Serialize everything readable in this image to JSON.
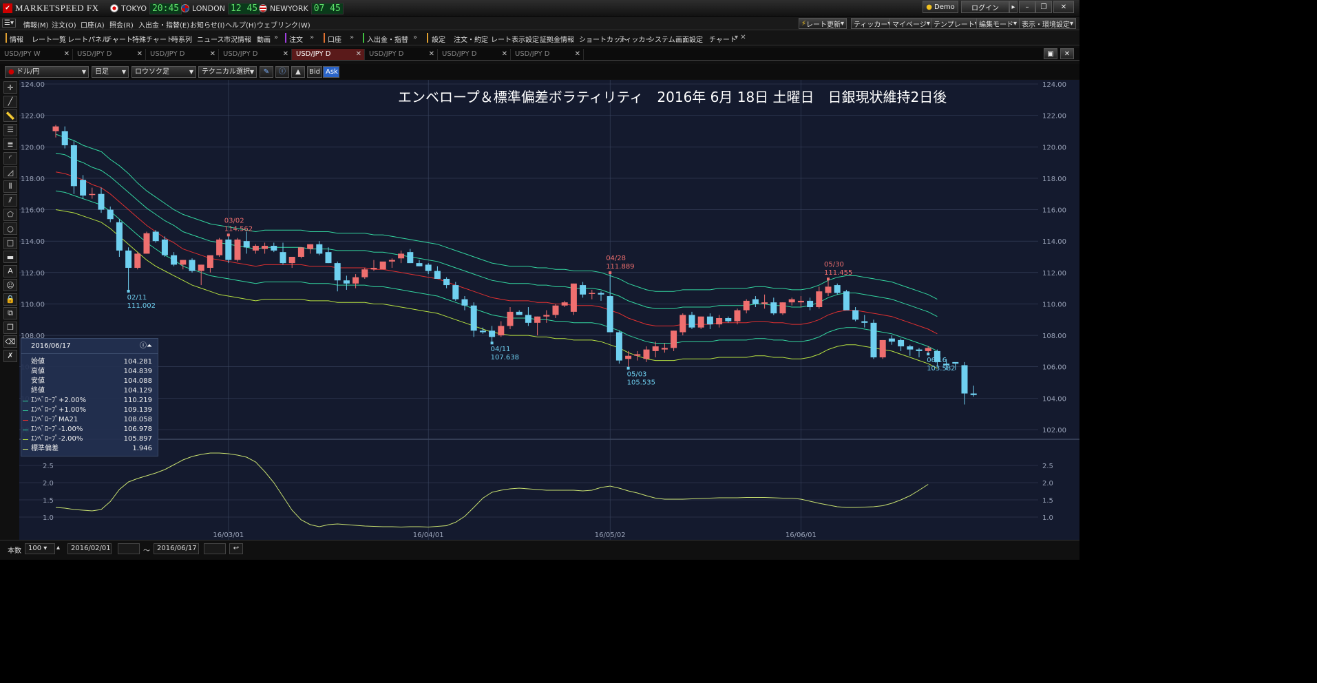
{
  "app": {
    "name": "MARKETSPEED FX"
  },
  "clocks": [
    {
      "city": "TOKYO",
      "time": "20:45"
    },
    {
      "city": "LONDON",
      "time": "12 45"
    },
    {
      "city": "NEWYORK",
      "time": "07 45"
    }
  ],
  "window_buttons": {
    "demo": "Demo",
    "login": "ログイン"
  },
  "menu": [
    "情報(M)",
    "注文(O)",
    "口座(A)",
    "照会(R)",
    "入出金・指替(E)",
    "お知らせ(I)",
    "ヘルプ(H)",
    "ウェブリンク(W)"
  ],
  "menu_right": [
    "レート更新",
    "ティッカー",
    "マイページ",
    "テンプレート",
    "編集モード",
    "表示・環境設定"
  ],
  "toolbar": [
    "情報",
    "レート一覧",
    "レートパネル",
    "チャート",
    "特殊チャート",
    "時系列",
    "ニュース",
    "市況情報",
    "動画",
    "注文",
    "口座",
    "入出金・指替",
    "設定",
    "注文・約定",
    "レート表示設定",
    "証拠金情報",
    "ショートカット",
    "ティッカー",
    "システム",
    "画面設定",
    "チャート"
  ],
  "tabs": [
    "USD/JPY W",
    "USD/JPY D",
    "USD/JPY D",
    "USD/JPY D",
    "USD/JPY D",
    "USD/JPY D",
    "USD/JPY D",
    "USD/JPY D"
  ],
  "active_tab": 4,
  "controls": {
    "pair": "ドル/円",
    "period": "日足",
    "chart_style": "ロウソク足",
    "technical": "テクニカル選択",
    "bid": "Bid",
    "ask": "Ask"
  },
  "chart_title": "エンベロープ＆標準偏差ボラティリティ　2016年 6月 18日 土曜日　日銀現状維持2日後",
  "info_panel": {
    "date": "2016/06/17",
    "rows": [
      {
        "label": "始値",
        "value": "104.281"
      },
      {
        "label": "高値",
        "value": "104.839"
      },
      {
        "label": "安値",
        "value": "104.088"
      },
      {
        "label": "終値",
        "value": "104.129"
      },
      {
        "label": "ｴﾝﾍﾞﾛｰﾌﾟ+2.00%",
        "value": "110.219",
        "color": "#33d6a0"
      },
      {
        "label": "ｴﾝﾍﾞﾛｰﾌﾟ+1.00%",
        "value": "109.139",
        "color": "#33d6a0"
      },
      {
        "label": "ｴﾝﾍﾞﾛｰﾌﾟMA21",
        "value": "108.058",
        "color": "#e03030"
      },
      {
        "label": "ｴﾝﾍﾞﾛｰﾌﾟ-1.00%",
        "value": "106.978",
        "color": "#33d6a0"
      },
      {
        "label": "ｴﾝﾍﾞﾛｰﾌﾟ-2.00%",
        "value": "105.897",
        "color": "#b6e040"
      },
      {
        "label": "標準偏差",
        "value": "1.946",
        "color": "#c8e070"
      }
    ]
  },
  "bottom": {
    "count_label": "本数",
    "count": "100",
    "from": "2016/02/01",
    "tilde": "〜",
    "to": "2016/06/17"
  },
  "colors": {
    "up": "#ef6f6f",
    "down": "#6fd0f0",
    "bg": "#141a2e",
    "grid": "#3a4560"
  },
  "chart_data": {
    "type": "candlestick",
    "ylim": [
      102,
      124
    ],
    "yticks": [
      "124.00",
      "122.00",
      "120.00",
      "118.00",
      "116.00",
      "114.00",
      "112.00",
      "110.00",
      "108.00",
      "106.00",
      "104.00",
      "102.00"
    ],
    "sub_ylim": [
      0.5,
      3.0
    ],
    "sub_yticks": [
      "2.5",
      "2.0",
      "1.5",
      "1.0"
    ],
    "xlabels": [
      {
        "i": 19,
        "label": "16/03/01"
      },
      {
        "i": 41,
        "label": "16/04/01"
      },
      {
        "i": 61,
        "label": "16/05/02"
      },
      {
        "i": 82,
        "label": "16/06/01"
      }
    ],
    "candles": [
      [
        121.0,
        121.4,
        120.6,
        121.3
      ],
      [
        121.0,
        121.3,
        119.9,
        120.1
      ],
      [
        120.1,
        120.4,
        117.0,
        117.5
      ],
      [
        117.9,
        118.2,
        116.7,
        116.9
      ],
      [
        117.0,
        117.4,
        116.7,
        117.0
      ],
      [
        117.0,
        117.4,
        115.8,
        116.0
      ],
      [
        116.0,
        116.2,
        115.2,
        115.4
      ],
      [
        115.2,
        115.4,
        113.0,
        113.4
      ],
      [
        113.4,
        113.6,
        110.9,
        112.3
      ],
      [
        112.3,
        113.3,
        112.2,
        113.2
      ],
      [
        113.2,
        114.6,
        113.2,
        114.5
      ],
      [
        114.6,
        114.7,
        113.9,
        114.0
      ],
      [
        114.1,
        114.3,
        113.0,
        113.1
      ],
      [
        113.1,
        113.3,
        112.4,
        112.5
      ],
      [
        112.5,
        112.8,
        112.2,
        112.8
      ],
      [
        112.8,
        112.9,
        112.0,
        112.1
      ],
      [
        112.1,
        112.5,
        111.2,
        112.5
      ],
      [
        112.3,
        113.0,
        112.0,
        113.1
      ],
      [
        113.1,
        114.2,
        113.0,
        114.1
      ],
      [
        114.1,
        114.3,
        112.6,
        112.8
      ],
      [
        112.8,
        114.2,
        112.7,
        114.1
      ],
      [
        114.0,
        114.6,
        113.2,
        113.6
      ],
      [
        113.4,
        113.8,
        113.2,
        113.7
      ],
      [
        113.5,
        113.9,
        113.2,
        113.7
      ],
      [
        113.7,
        113.9,
        113.3,
        113.4
      ],
      [
        113.3,
        113.9,
        112.5,
        112.6
      ],
      [
        112.6,
        113.0,
        112.3,
        113.0
      ],
      [
        113.0,
        113.4,
        112.9,
        113.6
      ],
      [
        113.5,
        113.8,
        113.2,
        113.8
      ],
      [
        113.8,
        114.0,
        113.1,
        113.2
      ],
      [
        113.3,
        113.6,
        112.6,
        112.6
      ],
      [
        112.6,
        112.7,
        110.8,
        111.5
      ],
      [
        111.5,
        111.8,
        110.9,
        111.3
      ],
      [
        111.3,
        111.9,
        111.0,
        111.7
      ],
      [
        111.7,
        112.3,
        111.6,
        112.2
      ],
      [
        112.2,
        112.8,
        112.1,
        112.3
      ],
      [
        112.2,
        112.6,
        112.2,
        112.7
      ],
      [
        112.7,
        112.9,
        112.3,
        112.8
      ],
      [
        112.9,
        113.4,
        112.6,
        113.2
      ],
      [
        113.3,
        113.5,
        112.6,
        112.6
      ],
      [
        112.6,
        112.8,
        112.4,
        112.4
      ],
      [
        112.5,
        112.6,
        111.9,
        112.1
      ],
      [
        112.1,
        112.4,
        111.6,
        111.6
      ],
      [
        111.6,
        111.7,
        111.0,
        111.2
      ],
      [
        111.2,
        111.4,
        110.2,
        110.3
      ],
      [
        110.3,
        110.5,
        109.6,
        109.9
      ],
      [
        109.9,
        110.1,
        107.9,
        108.3
      ],
      [
        108.3,
        108.5,
        108.1,
        108.2
      ],
      [
        108.3,
        108.6,
        107.6,
        107.9
      ],
      [
        108.0,
        108.9,
        107.9,
        108.6
      ],
      [
        108.6,
        109.8,
        108.4,
        109.5
      ],
      [
        109.5,
        109.6,
        109.3,
        109.3
      ],
      [
        109.3,
        109.8,
        108.6,
        108.8
      ],
      [
        108.8,
        109.2,
        108.0,
        109.2
      ],
      [
        109.2,
        109.6,
        108.8,
        109.3
      ],
      [
        109.3,
        110.0,
        109.1,
        109.9
      ],
      [
        109.9,
        110.2,
        109.8,
        110.1
      ],
      [
        109.5,
        111.3,
        109.3,
        111.3
      ],
      [
        111.2,
        111.4,
        110.4,
        110.6
      ],
      [
        110.7,
        110.9,
        110.3,
        110.7
      ],
      [
        110.7,
        110.8,
        110.2,
        110.6
      ],
      [
        110.5,
        111.9,
        108.9,
        108.2
      ],
      [
        108.2,
        108.3,
        106.2,
        106.4
      ],
      [
        106.5,
        107.0,
        106.0,
        106.7
      ],
      [
        106.7,
        107.0,
        106.4,
        106.8
      ],
      [
        106.5,
        107.3,
        106.3,
        107.1
      ],
      [
        107.0,
        107.6,
        106.6,
        107.3
      ],
      [
        107.1,
        107.5,
        106.9,
        107.2
      ],
      [
        107.2,
        108.3,
        107.0,
        108.3
      ],
      [
        108.2,
        109.4,
        108.0,
        109.3
      ],
      [
        109.3,
        109.5,
        108.4,
        108.5
      ],
      [
        108.5,
        109.2,
        108.4,
        109.2
      ],
      [
        109.2,
        109.4,
        108.4,
        108.7
      ],
      [
        108.7,
        109.3,
        108.5,
        109.1
      ],
      [
        109.1,
        109.2,
        108.8,
        108.9
      ],
      [
        108.9,
        109.7,
        108.7,
        109.6
      ],
      [
        109.6,
        110.3,
        109.4,
        110.2
      ],
      [
        110.3,
        110.5,
        109.8,
        110.0
      ],
      [
        110.0,
        110.6,
        109.7,
        110.1
      ],
      [
        110.1,
        110.4,
        109.3,
        109.4
      ],
      [
        109.4,
        110.1,
        109.3,
        110.1
      ],
      [
        110.1,
        110.4,
        109.9,
        110.3
      ],
      [
        110.1,
        110.5,
        109.8,
        110.2
      ],
      [
        110.2,
        110.4,
        109.6,
        109.8
      ],
      [
        109.8,
        111.1,
        109.7,
        110.8
      ],
      [
        110.7,
        111.5,
        110.5,
        111.1
      ],
      [
        111.2,
        111.3,
        110.6,
        110.7
      ],
      [
        110.8,
        110.9,
        109.8,
        109.6
      ],
      [
        109.6,
        109.8,
        108.9,
        109.0
      ],
      [
        108.9,
        109.3,
        108.5,
        108.8
      ],
      [
        108.8,
        109.0,
        106.5,
        106.6
      ],
      [
        106.6,
        107.7,
        106.5,
        107.7
      ],
      [
        107.8,
        108.0,
        107.4,
        107.6
      ],
      [
        107.7,
        107.8,
        107.0,
        107.3
      ],
      [
        107.3,
        107.4,
        106.7,
        107.1
      ],
      [
        107.1,
        107.2,
        106.6,
        107.0
      ],
      [
        107.0,
        107.3,
        106.9,
        107.2
      ],
      [
        107.0,
        107.1,
        106.0,
        106.3
      ],
      [
        106.2,
        106.5,
        105.8,
        106.1
      ],
      [
        106.3,
        106.2,
        105.8,
        106.2
      ],
      [
        106.1,
        106.3,
        103.6,
        104.3
      ],
      [
        104.3,
        104.8,
        104.1,
        104.2
      ]
    ],
    "env_p2": [
      120.8,
      120.6,
      120.4,
      120.1,
      119.9,
      119.7,
      119.2,
      118.8,
      118.3,
      117.7,
      117.2,
      116.8,
      116.4,
      116.0,
      115.7,
      115.5,
      115.3,
      115.1,
      115.0,
      114.9,
      114.8,
      114.7,
      114.6,
      114.7,
      114.7,
      114.7,
      114.7,
      114.7,
      114.6,
      114.6,
      114.6,
      114.5,
      114.5,
      114.5,
      114.5,
      114.4,
      114.4,
      114.3,
      114.2,
      114.1,
      114.0,
      113.9,
      113.8,
      113.6,
      113.4,
      113.2,
      113.0,
      112.8,
      112.6,
      112.5,
      112.4,
      112.4,
      112.4,
      112.3,
      112.3,
      112.2,
      112.2,
      112.1,
      112.1,
      112.1,
      112.0,
      111.8,
      111.6,
      111.3,
      111.1,
      110.9,
      110.8,
      110.8,
      110.8,
      110.9,
      110.9,
      110.9,
      110.9,
      111.0,
      111.0,
      111.0,
      111.0,
      111.1,
      111.1,
      111.0,
      111.0,
      110.9,
      110.9,
      111.0,
      111.2,
      111.5,
      111.7,
      111.8,
      111.8,
      111.7,
      111.6,
      111.5,
      111.4,
      111.2,
      111.0,
      110.8,
      110.6,
      110.3
    ],
    "env_p1": [
      119.6,
      119.5,
      119.2,
      119.0,
      118.7,
      118.5,
      118.1,
      117.6,
      117.1,
      116.6,
      116.1,
      115.7,
      115.3,
      115.0,
      114.6,
      114.4,
      114.2,
      114.0,
      113.9,
      113.8,
      113.7,
      113.6,
      113.5,
      113.6,
      113.6,
      113.6,
      113.6,
      113.6,
      113.5,
      113.5,
      113.5,
      113.4,
      113.4,
      113.4,
      113.4,
      113.3,
      113.3,
      113.2,
      113.1,
      113.0,
      112.9,
      112.8,
      112.7,
      112.5,
      112.3,
      112.1,
      111.9,
      111.7,
      111.5,
      111.4,
      111.3,
      111.3,
      111.3,
      111.2,
      111.2,
      111.1,
      111.1,
      111.0,
      111.0,
      111.0,
      110.9,
      110.7,
      110.5,
      110.2,
      110.0,
      109.8,
      109.7,
      109.7,
      109.7,
      109.8,
      109.8,
      109.8,
      109.8,
      109.9,
      109.9,
      109.9,
      109.9,
      110.0,
      110.0,
      109.9,
      109.9,
      109.8,
      109.8,
      109.9,
      110.1,
      110.4,
      110.6,
      110.7,
      110.7,
      110.6,
      110.5,
      110.4,
      110.3,
      110.1,
      109.9,
      109.7,
      109.5,
      109.2
    ],
    "env_ma": [
      118.4,
      118.3,
      118.1,
      117.9,
      117.6,
      117.4,
      117.0,
      116.5,
      116.0,
      115.5,
      115.0,
      114.6,
      114.2,
      113.9,
      113.5,
      113.3,
      113.1,
      112.9,
      112.8,
      112.7,
      112.6,
      112.5,
      112.4,
      112.5,
      112.5,
      112.5,
      112.5,
      112.5,
      112.4,
      112.4,
      112.4,
      112.3,
      112.3,
      112.3,
      112.3,
      112.2,
      112.2,
      112.1,
      112.0,
      111.9,
      111.8,
      111.7,
      111.6,
      111.4,
      111.2,
      111.0,
      110.8,
      110.6,
      110.4,
      110.3,
      110.2,
      110.2,
      110.2,
      110.1,
      110.1,
      110.0,
      110.0,
      109.9,
      109.9,
      109.9,
      109.8,
      109.6,
      109.4,
      109.1,
      108.9,
      108.7,
      108.6,
      108.6,
      108.6,
      108.7,
      108.7,
      108.7,
      108.7,
      108.8,
      108.8,
      108.8,
      108.8,
      108.9,
      108.9,
      108.8,
      108.8,
      108.7,
      108.7,
      108.8,
      109.0,
      109.3,
      109.5,
      109.6,
      109.6,
      109.5,
      109.4,
      109.3,
      109.2,
      109.0,
      108.8,
      108.6,
      108.4,
      108.1
    ],
    "env_m1": [
      117.2,
      117.1,
      116.9,
      116.7,
      116.5,
      116.3,
      115.9,
      115.4,
      114.9,
      114.4,
      113.9,
      113.5,
      113.1,
      112.8,
      112.4,
      112.2,
      112.0,
      111.8,
      111.7,
      111.6,
      111.5,
      111.4,
      111.3,
      111.4,
      111.4,
      111.4,
      111.4,
      111.4,
      111.3,
      111.3,
      111.3,
      111.2,
      111.2,
      111.2,
      111.2,
      111.1,
      111.1,
      111.0,
      110.9,
      110.8,
      110.7,
      110.6,
      110.5,
      110.3,
      110.1,
      109.9,
      109.7,
      109.5,
      109.3,
      109.2,
      109.1,
      109.1,
      109.1,
      109.0,
      109.0,
      108.9,
      108.9,
      108.8,
      108.8,
      108.8,
      108.7,
      108.5,
      108.3,
      108.0,
      107.8,
      107.6,
      107.5,
      107.5,
      107.5,
      107.6,
      107.6,
      107.6,
      107.6,
      107.7,
      107.7,
      107.7,
      107.7,
      107.8,
      107.8,
      107.7,
      107.7,
      107.6,
      107.6,
      107.7,
      107.9,
      108.2,
      108.4,
      108.5,
      108.5,
      108.4,
      108.3,
      108.2,
      108.1,
      107.9,
      107.7,
      107.5,
      107.3,
      107.0
    ],
    "env_m2": [
      116.0,
      115.9,
      115.8,
      115.6,
      115.4,
      115.2,
      114.8,
      114.3,
      113.8,
      113.3,
      112.8,
      112.4,
      112.1,
      111.8,
      111.5,
      111.2,
      111.0,
      110.8,
      110.6,
      110.5,
      110.4,
      110.3,
      110.2,
      110.3,
      110.3,
      110.3,
      110.3,
      110.3,
      110.2,
      110.2,
      110.2,
      110.1,
      110.1,
      110.1,
      110.1,
      110.0,
      110.0,
      109.9,
      109.8,
      109.7,
      109.6,
      109.5,
      109.4,
      109.2,
      109.0,
      108.8,
      108.6,
      108.4,
      108.2,
      108.1,
      108.0,
      108.0,
      108.0,
      107.9,
      107.9,
      107.8,
      107.8,
      107.7,
      107.7,
      107.7,
      107.6,
      107.4,
      107.2,
      106.9,
      106.7,
      106.5,
      106.4,
      106.4,
      106.4,
      106.5,
      106.5,
      106.5,
      106.5,
      106.6,
      106.6,
      106.6,
      106.6,
      106.7,
      106.7,
      106.6,
      106.6,
      106.5,
      106.5,
      106.6,
      106.8,
      107.1,
      107.3,
      107.4,
      107.4,
      107.3,
      107.2,
      107.1,
      107.0,
      106.8,
      106.6,
      106.4,
      106.2,
      105.9
    ],
    "stddev": [
      1.28,
      1.26,
      1.22,
      1.2,
      1.18,
      1.22,
      1.45,
      1.8,
      2.02,
      2.12,
      2.2,
      2.28,
      2.38,
      2.52,
      2.66,
      2.76,
      2.82,
      2.86,
      2.86,
      2.84,
      2.8,
      2.74,
      2.6,
      2.32,
      2.0,
      1.6,
      1.2,
      0.92,
      0.78,
      0.72,
      0.78,
      0.8,
      0.78,
      0.76,
      0.74,
      0.73,
      0.72,
      0.72,
      0.71,
      0.72,
      0.72,
      0.71,
      0.73,
      0.75,
      0.85,
      1.02,
      1.28,
      1.55,
      1.72,
      1.78,
      1.82,
      1.84,
      1.82,
      1.8,
      1.78,
      1.78,
      1.78,
      1.78,
      1.76,
      1.78,
      1.86,
      1.9,
      1.84,
      1.76,
      1.7,
      1.62,
      1.55,
      1.52,
      1.52,
      1.52,
      1.53,
      1.54,
      1.55,
      1.56,
      1.56,
      1.56,
      1.57,
      1.57,
      1.57,
      1.56,
      1.55,
      1.55,
      1.52,
      1.46,
      1.4,
      1.35,
      1.3,
      1.28,
      1.28,
      1.29,
      1.3,
      1.33,
      1.4,
      1.5,
      1.62,
      1.78,
      1.95
    ],
    "annotations": [
      {
        "i": 8,
        "date": "02/11",
        "value": "111.002",
        "pos": "low"
      },
      {
        "i": 19,
        "date": "03/02",
        "value": "114.562",
        "pos": "high"
      },
      {
        "i": 48,
        "date": "04/11",
        "value": "107.638",
        "pos": "low"
      },
      {
        "i": 61,
        "date": "04/28",
        "value": "111.889",
        "pos": "high"
      },
      {
        "i": 63,
        "date": "05/03",
        "value": "105.535",
        "pos": "low"
      },
      {
        "i": 85,
        "date": "05/30",
        "value": "111.455",
        "pos": "high"
      },
      {
        "i": 96,
        "date": "06/16",
        "value": "103.582",
        "pos": "low"
      }
    ]
  }
}
